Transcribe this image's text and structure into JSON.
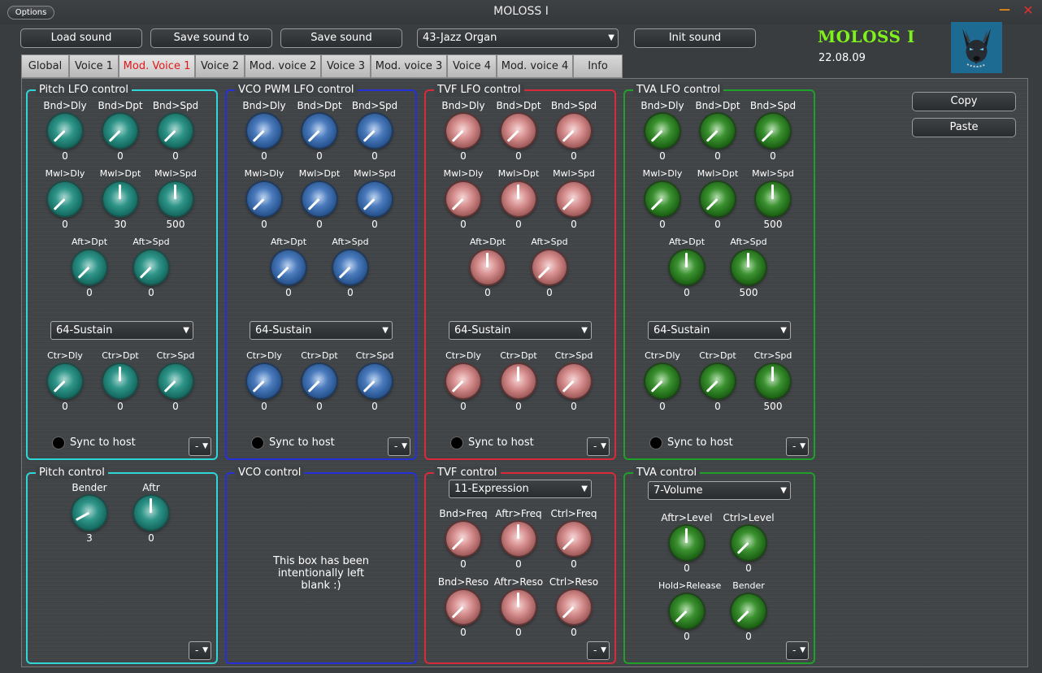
{
  "window": {
    "title": "MOLOSS I",
    "options": "Options",
    "minimize": "—",
    "close": "✕"
  },
  "header": {
    "load": "Load sound",
    "save_to": "Save sound to",
    "save": "Save sound",
    "preset": "43-Jazz Organ",
    "init": "Init sound",
    "logo": "MOLOSS I",
    "version": "22.08.09"
  },
  "tabs": [
    "Global",
    "Voice 1",
    "Mod. Voice 1",
    "Voice 2",
    "Mod. voice 2",
    "Voice 3",
    "Mod. voice 3",
    "Voice 4",
    "Mod. voice 4",
    "Info"
  ],
  "active_tab": "Mod. Voice 1",
  "side": {
    "copy": "Copy",
    "paste": "Paste"
  },
  "lfo_panels": [
    {
      "id": "pitch",
      "title": "Pitch LFO control",
      "color": "#2fd6d6",
      "knob": "cyan",
      "row1": [
        {
          "label": "Bnd>Dly",
          "value": "0",
          "level": 0
        },
        {
          "label": "Bnd>Dpt",
          "value": "0",
          "level": 0
        },
        {
          "label": "Bnd>Spd",
          "value": "0",
          "level": 0
        }
      ],
      "row2": [
        {
          "label": "Mwl>Dly",
          "value": "0",
          "level": 0
        },
        {
          "label": "Mwl>Dpt",
          "value": "30",
          "level": 0.5
        },
        {
          "label": "Mwl>Spd",
          "value": "500",
          "level": 0.5
        }
      ],
      "row3": [
        {
          "label": "Aft>Dpt",
          "value": "0",
          "level": 0
        },
        {
          "label": "Aft>Spd",
          "value": "0",
          "level": 0
        }
      ],
      "dropdown": "64-Sustain",
      "row4": [
        {
          "label": "Ctr>Dly",
          "value": "0",
          "level": 0
        },
        {
          "label": "Ctr>Dpt",
          "value": "0",
          "level": 0.5
        },
        {
          "label": "Ctr>Spd",
          "value": "0",
          "level": 0
        }
      ],
      "sync": "Sync to host",
      "mini": "-"
    },
    {
      "id": "vco",
      "title": "VCO PWM LFO control",
      "color": "#2530d8",
      "knob": "blue",
      "row1": [
        {
          "label": "Bnd>Dly",
          "value": "0",
          "level": 0
        },
        {
          "label": "Bnd>Dpt",
          "value": "0",
          "level": 0
        },
        {
          "label": "Bnd>Spd",
          "value": "0",
          "level": 0
        }
      ],
      "row2": [
        {
          "label": "Mwl>Dly",
          "value": "0",
          "level": 0
        },
        {
          "label": "Mwl>Dpt",
          "value": "0",
          "level": 0
        },
        {
          "label": "Mwl>Spd",
          "value": "0",
          "level": 0
        }
      ],
      "row3": [
        {
          "label": "Aft>Dpt",
          "value": "0",
          "level": 0
        },
        {
          "label": "Aft>Spd",
          "value": "0",
          "level": 0
        }
      ],
      "dropdown": "64-Sustain",
      "row4": [
        {
          "label": "Ctr>Dly",
          "value": "0",
          "level": 0
        },
        {
          "label": "Ctr>Dpt",
          "value": "0",
          "level": 0
        },
        {
          "label": "Ctr>Spd",
          "value": "0",
          "level": 0
        }
      ],
      "sync": "Sync to host",
      "mini": "-"
    },
    {
      "id": "tvf",
      "title": "TVF LFO control",
      "color": "#d82a3a",
      "knob": "red",
      "row1": [
        {
          "label": "Bnd>Dly",
          "value": "0",
          "level": 0
        },
        {
          "label": "Bnd>Dpt",
          "value": "0",
          "level": 0
        },
        {
          "label": "Bnd>Spd",
          "value": "0",
          "level": 0
        }
      ],
      "row2": [
        {
          "label": "Mwl>Dly",
          "value": "0",
          "level": 0
        },
        {
          "label": "Mwl>Dpt",
          "value": "0",
          "level": 0.5
        },
        {
          "label": "Mwl>Spd",
          "value": "0",
          "level": 0
        }
      ],
      "row3": [
        {
          "label": "Aft>Dpt",
          "value": "0",
          "level": 0.5
        },
        {
          "label": "Aft>Spd",
          "value": "0",
          "level": 0
        }
      ],
      "dropdown": "64-Sustain",
      "row4": [
        {
          "label": "Ctr>Dly",
          "value": "0",
          "level": 0
        },
        {
          "label": "Ctr>Dpt",
          "value": "0",
          "level": 0.5
        },
        {
          "label": "Ctr>Spd",
          "value": "0",
          "level": 0
        }
      ],
      "sync": "Sync to host",
      "mini": "-"
    },
    {
      "id": "tva",
      "title": "TVA LFO control",
      "color": "#1fa02a",
      "knob": "green",
      "row1": [
        {
          "label": "Bnd>Dly",
          "value": "0",
          "level": 0
        },
        {
          "label": "Bnd>Dpt",
          "value": "0",
          "level": 0
        },
        {
          "label": "Bnd>Spd",
          "value": "0",
          "level": 0
        }
      ],
      "row2": [
        {
          "label": "Mwl>Dly",
          "value": "0",
          "level": 0
        },
        {
          "label": "Mwl>Dpt",
          "value": "0",
          "level": 0
        },
        {
          "label": "Mwl>Spd",
          "value": "500",
          "level": 0.5
        }
      ],
      "row3": [
        {
          "label": "Aft>Dpt",
          "value": "0",
          "level": 0.5
        },
        {
          "label": "Aft>Spd",
          "value": "500",
          "level": 0.5
        }
      ],
      "dropdown": "64-Sustain",
      "row4": [
        {
          "label": "Ctr>Dly",
          "value": "0",
          "level": 0
        },
        {
          "label": "Ctr>Dpt",
          "value": "0",
          "level": 0
        },
        {
          "label": "Ctr>Spd",
          "value": "500",
          "level": 0.5
        }
      ],
      "sync": "Sync to host",
      "mini": "-"
    }
  ],
  "pitch_control": {
    "title": "Pitch control",
    "knobs": [
      {
        "label": "Bender",
        "value": "3",
        "level": 0.06
      },
      {
        "label": "Aftr",
        "value": "0",
        "level": 0.5
      }
    ],
    "mini": "-"
  },
  "vco_control": {
    "title": "VCO control",
    "blank": "This box has been intentionally left blank :)"
  },
  "tvf_control": {
    "title": "TVF control",
    "dropdown": "11-Expression",
    "row1": [
      {
        "label": "Bnd>Freq",
        "value": "0",
        "level": 0
      },
      {
        "label": "Aftr>Freq",
        "value": "0",
        "level": 0.5
      },
      {
        "label": "Ctrl>Freq",
        "value": "0",
        "level": 0
      }
    ],
    "row2": [
      {
        "label": "Bnd>Reso",
        "value": "0",
        "level": 0
      },
      {
        "label": "Aftr>Reso",
        "value": "0",
        "level": 0.5
      },
      {
        "label": "Ctrl>Reso",
        "value": "0",
        "level": 0
      }
    ],
    "mini": "-"
  },
  "tva_control": {
    "title": "TVA control",
    "dropdown": "7-Volume",
    "row1": [
      {
        "label": "Aftr>Level",
        "value": "0",
        "level": 0.5
      },
      {
        "label": "Ctrl>Level",
        "value": "0",
        "level": 0
      }
    ],
    "row2": [
      {
        "label": "Hold>Release",
        "value": "0",
        "level": 0
      },
      {
        "label": "Bender",
        "value": "0",
        "level": 0
      }
    ],
    "mini": "-"
  }
}
